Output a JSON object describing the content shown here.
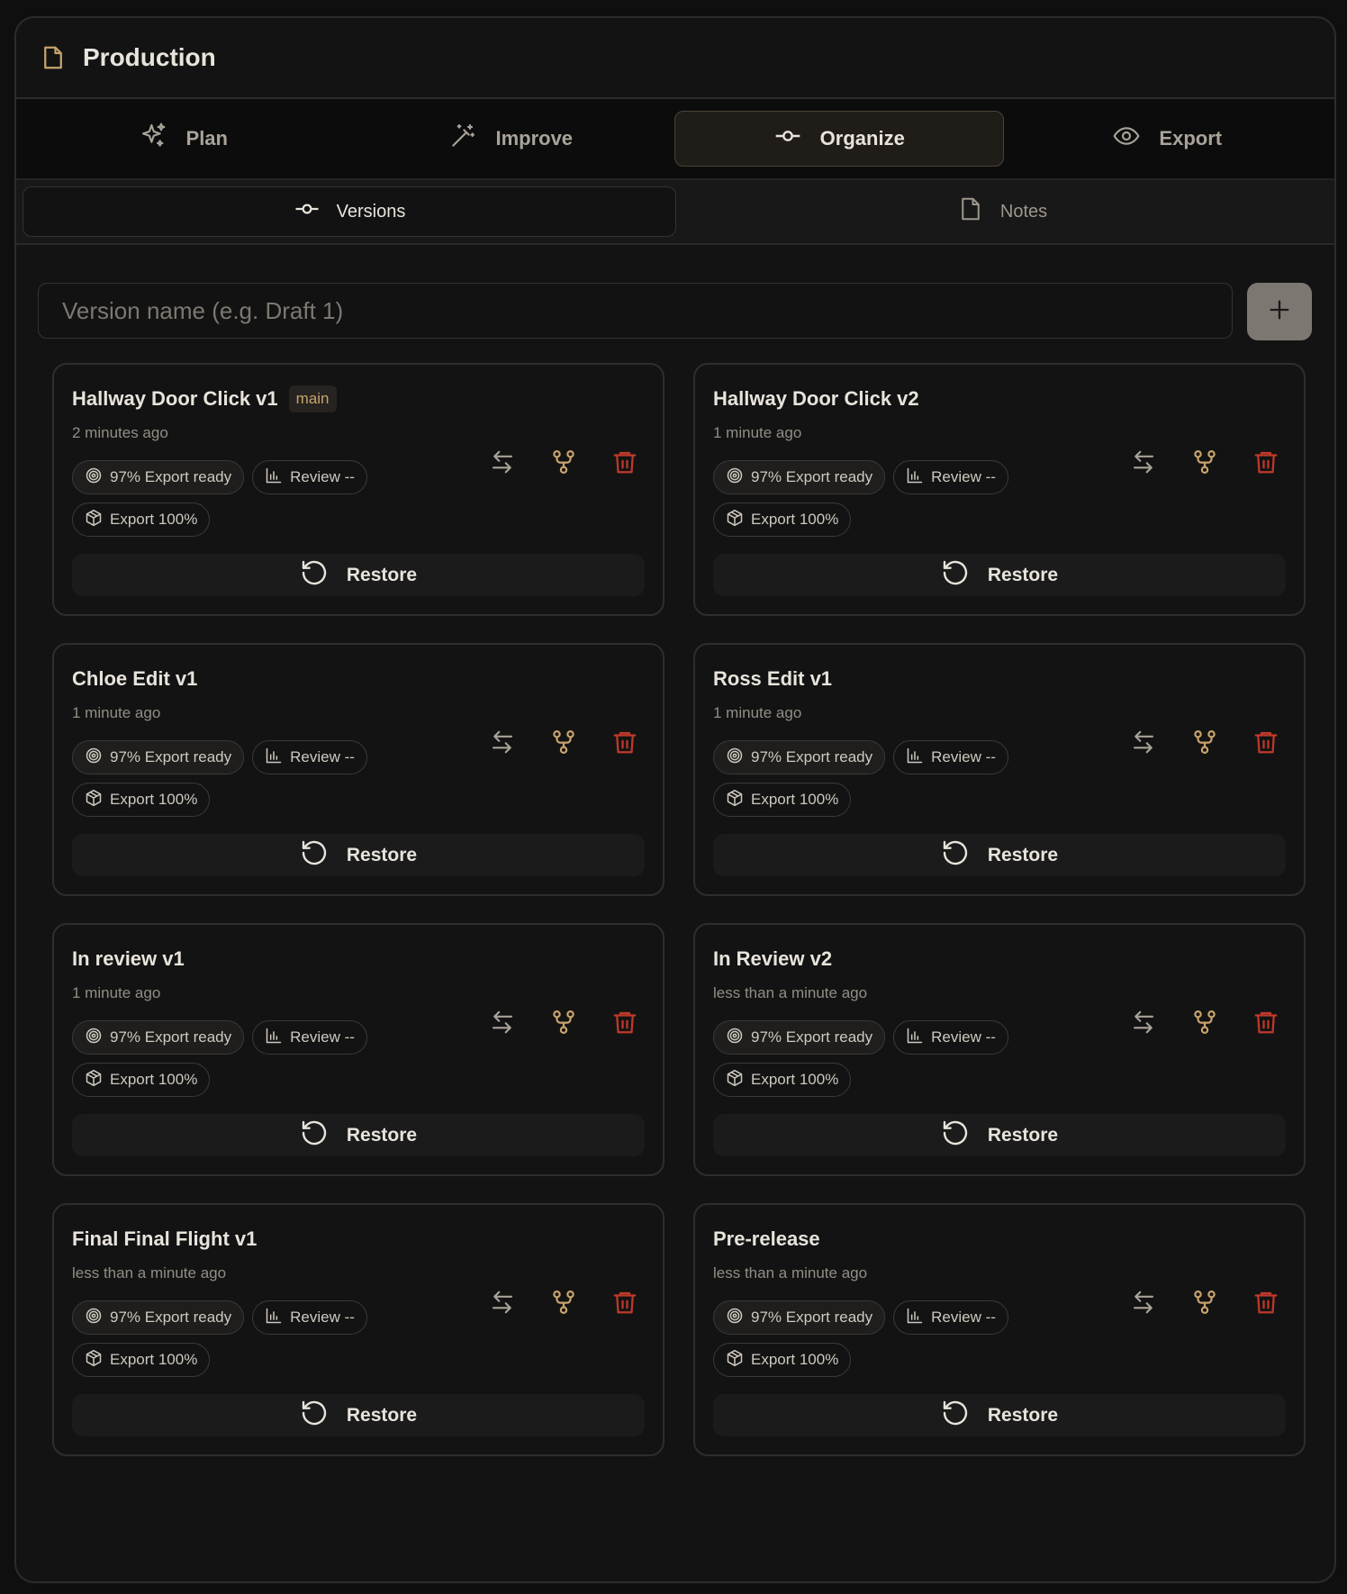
{
  "app": {
    "title": "Production"
  },
  "tabs": [
    {
      "label": "Plan",
      "icon": "sparkles-icon",
      "active": false
    },
    {
      "label": "Improve",
      "icon": "magic-wand-icon",
      "active": false
    },
    {
      "label": "Organize",
      "icon": "git-commit-icon",
      "active": true
    },
    {
      "label": "Export",
      "icon": "eye-icon",
      "active": false
    }
  ],
  "subtabs": [
    {
      "label": "Versions",
      "icon": "git-commit-icon",
      "active": true
    },
    {
      "label": "Notes",
      "icon": "document-icon",
      "active": false
    }
  ],
  "version_input": {
    "placeholder": "Version name (e.g. Draft 1)",
    "value": ""
  },
  "add_button": {
    "icon": "plus-icon"
  },
  "chip_labels": {
    "ready": "97% Export ready",
    "review": "Review --",
    "export": "Export 100%"
  },
  "restore_label": "Restore",
  "colors": {
    "accent": "#c8a46c",
    "danger": "#c0392b",
    "background": "#131313"
  },
  "versions": [
    {
      "name": "Hallway Door Click v1",
      "tag": "main",
      "time": "2 minutes ago"
    },
    {
      "name": "Hallway Door Click v2",
      "tag": "",
      "time": "1 minute ago"
    },
    {
      "name": "Chloe Edit v1",
      "tag": "",
      "time": "1 minute ago"
    },
    {
      "name": "Ross Edit v1",
      "tag": "",
      "time": "1 minute ago"
    },
    {
      "name": "In review v1",
      "tag": "",
      "time": "1 minute ago"
    },
    {
      "name": "In Review v2",
      "tag": "",
      "time": "less than a minute ago"
    },
    {
      "name": "Final Final Flight v1",
      "tag": "",
      "time": "less than a minute ago"
    },
    {
      "name": "Pre-release",
      "tag": "",
      "time": "less than a minute ago"
    }
  ]
}
